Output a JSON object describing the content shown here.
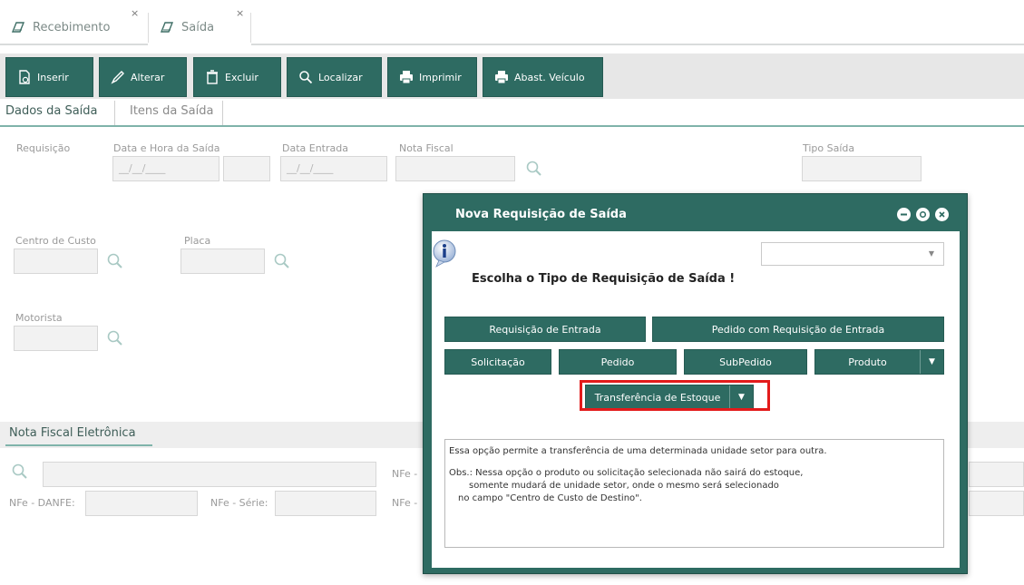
{
  "tabs": [
    {
      "label": "Recebimento",
      "close": "×"
    },
    {
      "label": "Saída",
      "close": "×"
    }
  ],
  "toolbar": {
    "inserir": "Inserir",
    "alterar": "Alterar",
    "excluir": "Excluir",
    "localizar": "Localizar",
    "imprimir": "Imprimir",
    "abast": "Abast. Veículo"
  },
  "subtabs": [
    "Dados da Saída",
    "Itens da Saída"
  ],
  "form": {
    "requisicao": "Requisição",
    "data_hora_saida": "Data e Hora da Saída",
    "date_placeholder": "__/__/____",
    "data_entrada": "Data Entrada",
    "nota_fiscal": "Nota Fiscal",
    "tipo_saida": "Tipo Saída",
    "centro_custo": "Centro de Custo",
    "placa": "Placa",
    "motorista": "Motorista"
  },
  "nfe": {
    "title": "Nota Fiscal Eletrônica",
    "nfe_label": "NFe -",
    "danfe": "NFe - DANFE:",
    "serie": "NFe - Série:"
  },
  "modal": {
    "title": "Nova Requisição de Saída",
    "prompt": "Escolha o Tipo de Requisição de Saída !",
    "buttons": {
      "req_entrada": "Requisição de Entrada",
      "pedido_req_entrada": "Pedido com Requisição de Entrada",
      "solicitacao": "Solicitação",
      "pedido": "Pedido",
      "subpedido": "SubPedido",
      "produto": "Produto",
      "transferencia": "Transferência de Estoque"
    },
    "description": {
      "line1": "Essa opção permite a transferência de uma determinada unidade setor para outra.",
      "line2": "Obs.: Nessa opção o produto ou solicitação selecionada não sairá do estoque,",
      "line3": "somente mudará de unidade setor, onde o mesmo será selecionado",
      "line4": "no campo \"Centro de Custo de Destino\"."
    }
  },
  "colors": {
    "primary": "#2e6b62",
    "highlight": "#e31b1b"
  }
}
